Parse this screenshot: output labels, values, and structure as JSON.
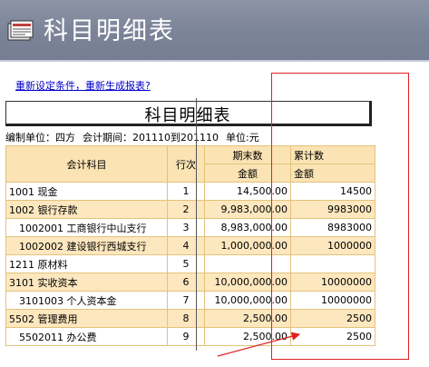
{
  "window": {
    "title": "科目明细表"
  },
  "link": {
    "reset": "重新设定条件，重新生成报表?"
  },
  "report": {
    "title": "科目明细表",
    "unit_label": "编制单位：四方",
    "period_label": "会计期间：201110到201110",
    "currency_label": "单位:元"
  },
  "table": {
    "headers": {
      "account": "会计科目",
      "seq": "行次",
      "period_end": "期末数",
      "cumulative": "累计数",
      "amount_end": "金额",
      "amount_cum": "金额"
    },
    "rows": [
      {
        "account": "1001 现金",
        "seq": "1",
        "end": "14,500.00",
        "cum": "14500",
        "indent": false
      },
      {
        "account": "1002 银行存款",
        "seq": "2",
        "end": "9,983,000.00",
        "cum": "9983000",
        "indent": false
      },
      {
        "account": "1002001 工商银行中山支行",
        "seq": "3",
        "end": "8,983,000.00",
        "cum": "8983000",
        "indent": true
      },
      {
        "account": "1002002 建设银行西城支行",
        "seq": "4",
        "end": "1,000,000.00",
        "cum": "1000000",
        "indent": true
      },
      {
        "account": "1211 原材料",
        "seq": "5",
        "end": "",
        "cum": "",
        "indent": false
      },
      {
        "account": "3101 实收资本",
        "seq": "6",
        "end": "10,000,000.00",
        "cum": "10000000",
        "indent": false
      },
      {
        "account": "3101003 个人资本金",
        "seq": "7",
        "end": "10,000,000.00",
        "cum": "10000000",
        "indent": true
      },
      {
        "account": "5502 管理费用",
        "seq": "8",
        "end": "2,500.00",
        "cum": "2500",
        "indent": false
      },
      {
        "account": "5502011 办公费",
        "seq": "9",
        "end": "2,500.00",
        "cum": "2500",
        "indent": true
      }
    ]
  },
  "colors": {
    "title_bar": "#7b8398",
    "header_fill": "#fbe3b3",
    "grid_line": "#e3c37a",
    "annotation": "#e02020"
  },
  "icons": {
    "app": "report-icon"
  }
}
